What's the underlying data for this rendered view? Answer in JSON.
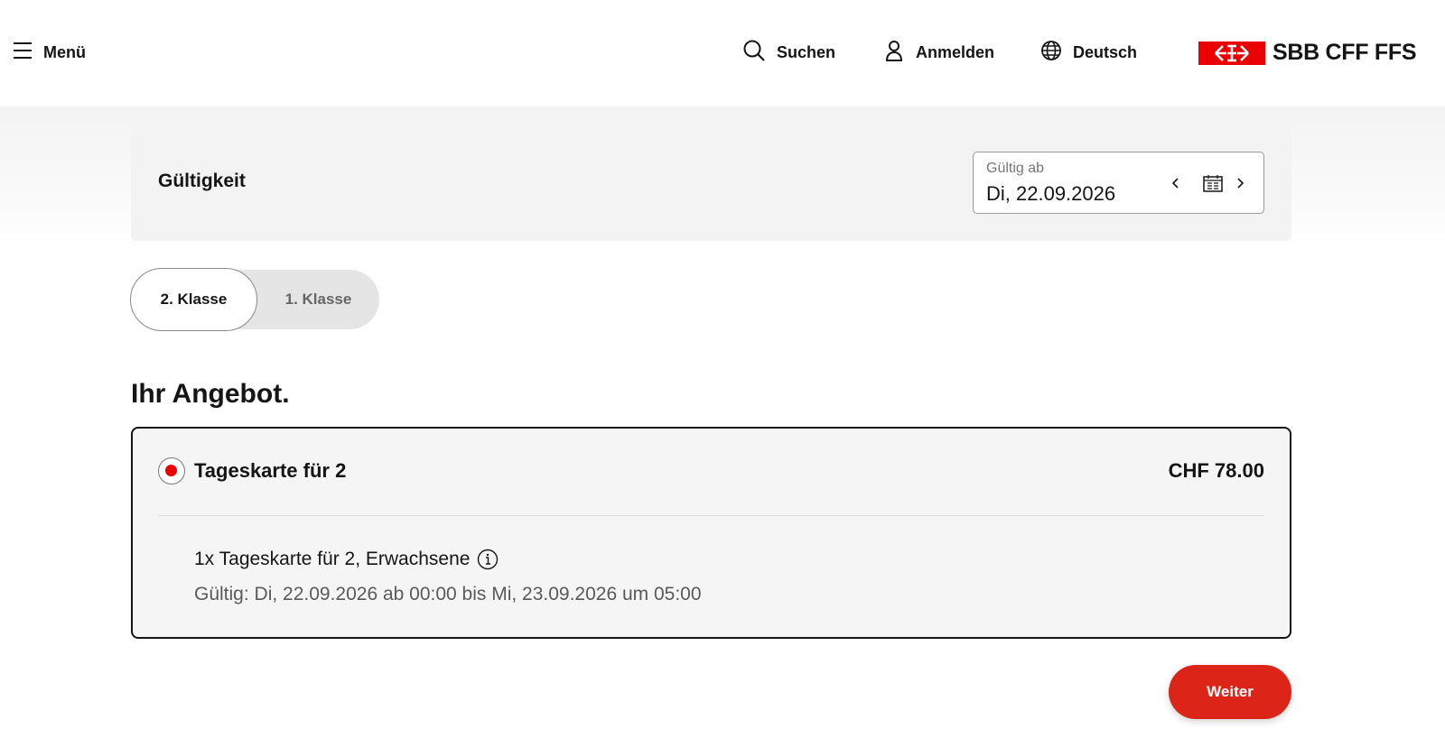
{
  "header": {
    "menu_label": "Menü",
    "search_label": "Suchen",
    "login_label": "Anmelden",
    "language_label": "Deutsch",
    "logo_text": "SBB CFF FFS",
    "brand_color": "#eb0000",
    "icons": {
      "menu": "hamburger-icon",
      "search": "search-icon",
      "login": "user-icon",
      "language": "globe-icon"
    }
  },
  "validity": {
    "title": "Gültigkeit",
    "date_label": "Gültig ab",
    "date_value": "Di, 22.09.2026"
  },
  "class_toggle": {
    "options": [
      "2. Klasse",
      "1. Klasse"
    ],
    "selected": "2. Klasse"
  },
  "offer": {
    "heading": "Ihr Angebot.",
    "product_name": "Tageskarte für 2",
    "price": "CHF 78.00",
    "selected": true,
    "detail": "1x Tageskarte für 2, Erwachsene",
    "validity_text": "Gültig: Di, 22.09.2026 ab 00:00 bis Mi, 23.09.2026 um 05:00"
  },
  "actions": {
    "next_label": "Weiter",
    "accent_color": "#dc2518"
  }
}
